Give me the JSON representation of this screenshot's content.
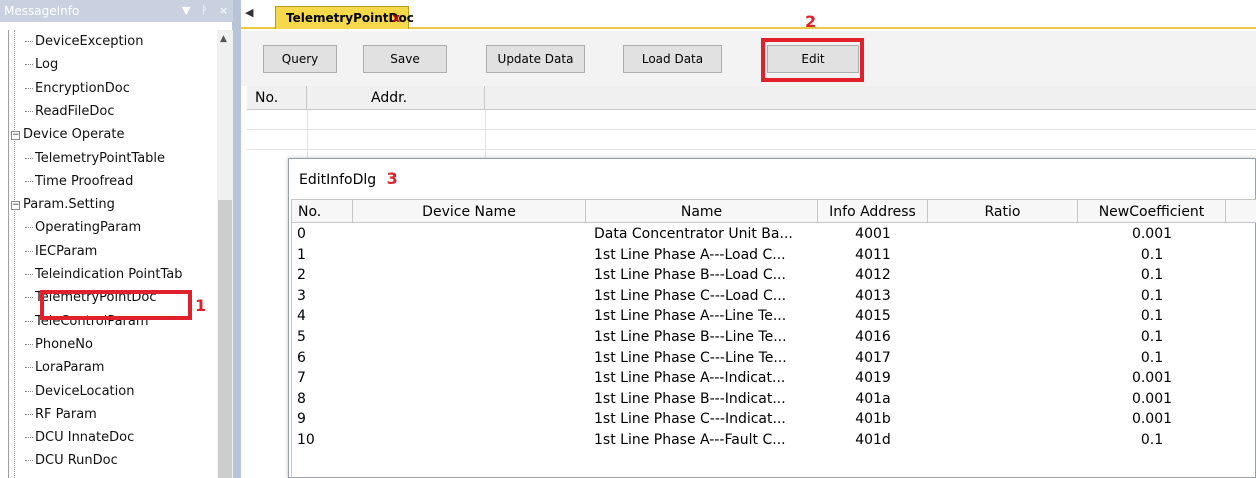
{
  "panel": {
    "title": "MessageInfo",
    "controls": [
      "▼",
      "ᚹ",
      "×"
    ]
  },
  "tree": [
    {
      "label": "DeviceException",
      "level": "child"
    },
    {
      "label": "Log",
      "level": "child"
    },
    {
      "label": "EncryptionDoc",
      "level": "child"
    },
    {
      "label": "ReadFileDoc",
      "level": "child"
    },
    {
      "label": "Device Operate",
      "level": "parent"
    },
    {
      "label": "TelemetryPointTable",
      "level": "child"
    },
    {
      "label": "Time Proofread",
      "level": "child"
    },
    {
      "label": "Param.Setting",
      "level": "parent"
    },
    {
      "label": "OperatingParam",
      "level": "child"
    },
    {
      "label": "IECParam",
      "level": "child"
    },
    {
      "label": "Teleindication PointTab",
      "level": "child"
    },
    {
      "label": "TelemetryPointDoc",
      "level": "child"
    },
    {
      "label": "TeleControlParam",
      "level": "child"
    },
    {
      "label": "PhoneNo",
      "level": "child"
    },
    {
      "label": "LoraParam",
      "level": "child"
    },
    {
      "label": "DeviceLocation",
      "level": "child"
    },
    {
      "label": "RF Param",
      "level": "child"
    },
    {
      "label": "DCU InnateDoc",
      "level": "child"
    },
    {
      "label": "DCU RunDoc",
      "level": "child"
    }
  ],
  "annotations": {
    "step1": "1",
    "step2": "2",
    "step3": "3"
  },
  "tab": {
    "label": "TelemetryPointDoc",
    "close": "x"
  },
  "toolbar": {
    "query": "Query",
    "save": "Save",
    "update": "Update Data",
    "load": "Load Data",
    "edit": "Edit"
  },
  "grid": {
    "headers": [
      "No.",
      "Addr."
    ]
  },
  "dialog": {
    "title": "EditInfoDlg",
    "headers": [
      "No.",
      "Device Name",
      "Name",
      "Info Address",
      "Ratio",
      "NewCoefficient"
    ],
    "rows": [
      {
        "no": "0",
        "device": "",
        "name": "Data Concentrator Unit Ba...",
        "addr": "4001",
        "ratio": "",
        "coef": "0.001"
      },
      {
        "no": "1",
        "device": "",
        "name": "1st Line Phase A---Load C...",
        "addr": "4011",
        "ratio": "",
        "coef": "0.1"
      },
      {
        "no": "2",
        "device": "",
        "name": "1st Line Phase B---Load C...",
        "addr": "4012",
        "ratio": "",
        "coef": "0.1"
      },
      {
        "no": "3",
        "device": "",
        "name": "1st Line Phase C---Load C...",
        "addr": "4013",
        "ratio": "",
        "coef": "0.1"
      },
      {
        "no": "4",
        "device": "",
        "name": "1st Line Phase A---Line Te...",
        "addr": "4015",
        "ratio": "",
        "coef": "0.1"
      },
      {
        "no": "5",
        "device": "",
        "name": "1st Line Phase B---Line Te...",
        "addr": "4016",
        "ratio": "",
        "coef": "0.1"
      },
      {
        "no": "6",
        "device": "",
        "name": "1st Line Phase C---Line Te...",
        "addr": "4017",
        "ratio": "",
        "coef": "0.1"
      },
      {
        "no": "7",
        "device": "",
        "name": "1st Line Phase A---Indicat...",
        "addr": "4019",
        "ratio": "",
        "coef": "0.001"
      },
      {
        "no": "8",
        "device": "",
        "name": "1st Line Phase B---Indicat...",
        "addr": "401a",
        "ratio": "",
        "coef": "0.001"
      },
      {
        "no": "9",
        "device": "",
        "name": "1st Line Phase C---Indicat...",
        "addr": "401b",
        "ratio": "",
        "coef": "0.001"
      },
      {
        "no": "10",
        "device": "",
        "name": "1st Line Phase A---Fault C...",
        "addr": "401d",
        "ratio": "",
        "coef": "0.1"
      }
    ]
  },
  "colors": {
    "highlight": "#e0202a",
    "tab": "#f5d94a",
    "panel_header": "#c9d1e0"
  }
}
